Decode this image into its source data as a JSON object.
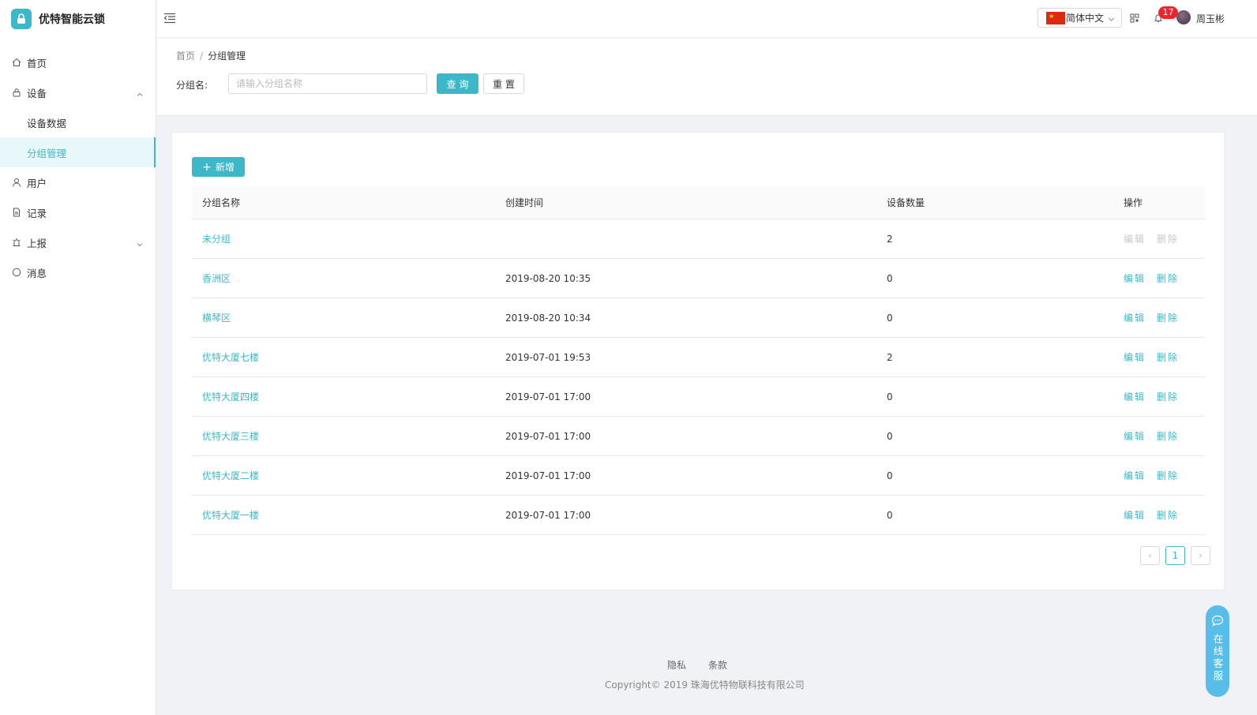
{
  "app": {
    "title": "优特智能云锁"
  },
  "sidebar": {
    "items": [
      {
        "label": "首页",
        "icon": "home-icon"
      },
      {
        "label": "设备",
        "icon": "lock-icon",
        "expanded": true
      },
      {
        "label": "设备数据",
        "sub": true
      },
      {
        "label": "分组管理",
        "sub": true,
        "active": true
      },
      {
        "label": "用户",
        "icon": "user-icon"
      },
      {
        "label": "记录",
        "icon": "file-icon"
      },
      {
        "label": "上报",
        "icon": "alarm-icon",
        "expandable": true
      },
      {
        "label": "消息",
        "icon": "circle-icon"
      }
    ]
  },
  "header": {
    "language": "简体中文",
    "notifications": "17",
    "username": "周玉彬"
  },
  "breadcrumb": {
    "home": "首页",
    "separator": "/",
    "current": "分组管理"
  },
  "search": {
    "label": "分组名:",
    "placeholder": "请输入分组名称",
    "value": "",
    "query_label": "查 询",
    "reset_label": "重 置"
  },
  "toolbar": {
    "add_label": "新增"
  },
  "table": {
    "columns": [
      "分组名称",
      "创建时间",
      "设备数量",
      "操作"
    ],
    "rows": [
      {
        "name": "未分组",
        "created": "",
        "count": "2",
        "edit": "编辑",
        "del": "删除",
        "disabled": true
      },
      {
        "name": "香洲区",
        "created": "2019-08-20 10:35",
        "count": "0",
        "edit": "编辑",
        "del": "删除"
      },
      {
        "name": "横琴区",
        "created": "2019-08-20 10:34",
        "count": "0",
        "edit": "编辑",
        "del": "删除"
      },
      {
        "name": "优特大厦七楼",
        "created": "2019-07-01 19:53",
        "count": "2",
        "edit": "编辑",
        "del": "删除"
      },
      {
        "name": "优特大厦四楼",
        "created": "2019-07-01 17:00",
        "count": "0",
        "edit": "编辑",
        "del": "删除"
      },
      {
        "name": "优特大厦三楼",
        "created": "2019-07-01 17:00",
        "count": "0",
        "edit": "编辑",
        "del": "删除"
      },
      {
        "name": "优特大厦二楼",
        "created": "2019-07-01 17:00",
        "count": "0",
        "edit": "编辑",
        "del": "删除"
      },
      {
        "name": "优特大厦一楼",
        "created": "2019-07-01 17:00",
        "count": "0",
        "edit": "编辑",
        "del": "删除"
      }
    ]
  },
  "pagination": {
    "current": "1",
    "prev": "‹",
    "next": "›"
  },
  "footer": {
    "privacy": "隐私",
    "terms": "条款",
    "copyright": "Copyright© 2019 珠海优特物联科技有限公司"
  },
  "support": {
    "label": "在线客服"
  },
  "colors": {
    "accent": "#3db8c8",
    "badge": "#f5222d",
    "support": "#58bde8"
  }
}
